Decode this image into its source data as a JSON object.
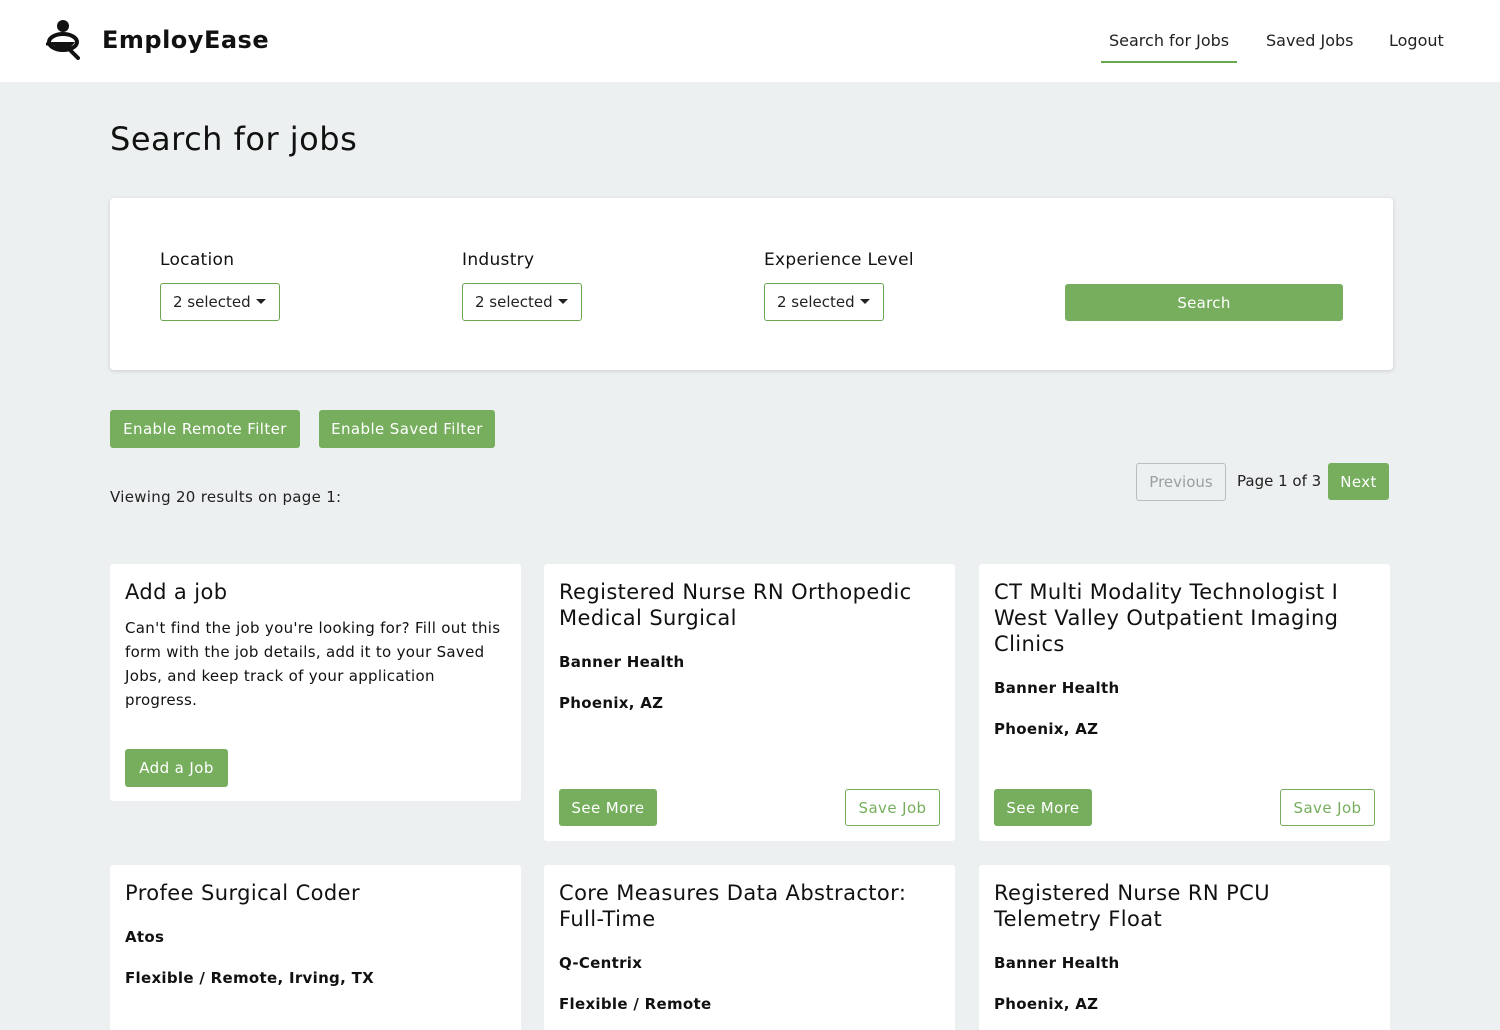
{
  "brand": {
    "name": "EmployEase"
  },
  "nav": {
    "search_jobs": "Search for Jobs",
    "saved_jobs": "Saved Jobs",
    "logout": "Logout"
  },
  "page": {
    "title": "Search for jobs"
  },
  "filters": {
    "location": {
      "label": "Location",
      "value": "2 selected"
    },
    "industry": {
      "label": "Industry",
      "value": "2 selected"
    },
    "experience": {
      "label": "Experience Level",
      "value": "2 selected"
    },
    "search_label": "Search"
  },
  "toggles": {
    "remote": "Enable Remote Filter",
    "saved": "Enable Saved Filter"
  },
  "results": {
    "summary": "Viewing 20 results on page 1:",
    "previous": "Previous",
    "page_text": "Page 1 of 3",
    "next": "Next"
  },
  "add_job_card": {
    "title": "Add a job",
    "description": "Can't find the job you're looking for? Fill out this form with the job details, add it to your Saved Jobs, and keep track of your application progress.",
    "button": "Add a Job"
  },
  "jobs": [
    {
      "title": "Registered Nurse RN Orthopedic Medical Surgical",
      "company": "Banner Health",
      "location": "Phoenix, AZ",
      "see_more": "See More",
      "save": "Save Job"
    },
    {
      "title": "CT Multi Modality Technologist I West Valley Outpatient Imaging Clinics",
      "company": "Banner Health",
      "location": "Phoenix, AZ",
      "see_more": "See More",
      "save": "Save Job"
    },
    {
      "title": "Profee Surgical Coder",
      "company": "Atos",
      "location": "Flexible / Remote, Irving, TX"
    },
    {
      "title": "Core Measures Data Abstractor: Full-Time",
      "company": "Q-Centrix",
      "location": "Flexible / Remote"
    },
    {
      "title": "Registered Nurse RN PCU Telemetry Float",
      "company": "Banner Health",
      "location": "Phoenix, AZ"
    }
  ],
  "colors": {
    "accent": "#76ae5d",
    "background": "#ecf0f0"
  }
}
